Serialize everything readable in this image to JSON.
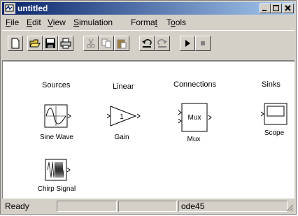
{
  "window": {
    "title": "untitled"
  },
  "menu": [
    "File",
    "Edit",
    "View",
    "Simulation",
    "Format",
    "Tools"
  ],
  "menu_accel": [
    "F",
    "E",
    "V",
    "S",
    "t",
    "o"
  ],
  "toolbar": [
    "new-icon",
    "open-icon",
    "save-icon",
    "print-icon",
    "cut-icon",
    "copy-icon",
    "paste-icon",
    "undo-icon",
    "redo-icon",
    "start-icon",
    "stop-icon"
  ],
  "categories": {
    "sources": "Sources",
    "linear": "Linear",
    "connections": "Connections",
    "sinks": "Sinks"
  },
  "blocks": {
    "sine_wave": "Sine Wave",
    "gain": "Gain",
    "gain_value": "1",
    "mux": "Mux",
    "mux_inner": "Mux",
    "scope": "Scope",
    "chirp": "Chirp Signal"
  },
  "status": {
    "left": "Ready",
    "cell2": "",
    "cell3": "",
    "solver": "ode45",
    "cell5": ""
  }
}
